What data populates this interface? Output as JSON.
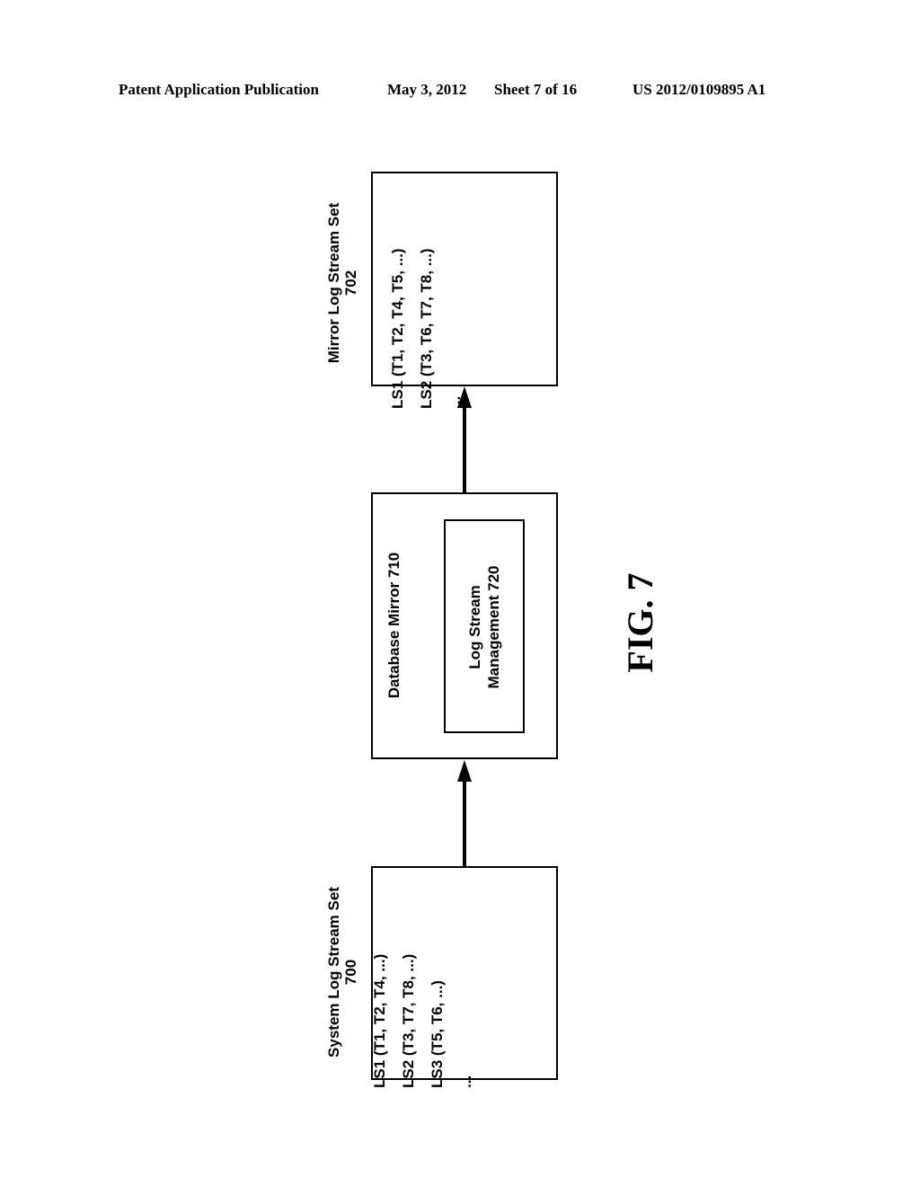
{
  "header": {
    "publication": "Patent Application Publication",
    "date": "May 3, 2012",
    "sheet": "Sheet 7 of 16",
    "number": "US 2012/0109895 A1"
  },
  "figure": {
    "label": "FIG. 7",
    "system_log_stream_set": {
      "title": "System Log Stream Set",
      "ref": "700",
      "entries": [
        "LS1 (T1, T2, T4, ...)",
        "LS2 (T3, T7, T8, ...)",
        "LS3 (T5, T6, ...)",
        "..."
      ]
    },
    "database_mirror": {
      "title": "Database Mirror 710",
      "inner": {
        "line1": "Log Stream",
        "line2": "Management 720"
      }
    },
    "mirror_log_stream_set": {
      "title": "Mirror Log Stream Set",
      "ref": "702",
      "entries": [
        "LS1 (T1, T2, T4, T5, ...)",
        "LS2 (T3, T6, T7, T8, ...)",
        "..."
      ]
    },
    "connections": [
      {
        "from": "system_log_stream_set",
        "to": "database_mirror"
      },
      {
        "from": "database_mirror",
        "to": "mirror_log_stream_set"
      }
    ]
  }
}
